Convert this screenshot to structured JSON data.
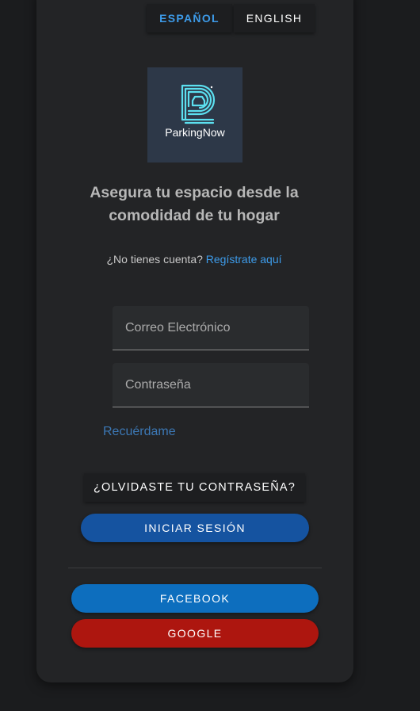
{
  "language": {
    "spanish": "ESPAÑOL",
    "english": "ENGLISH",
    "active": "ESPAÑOL",
    "active_color": "#3d9be9"
  },
  "logo": {
    "text": "ParkingNow",
    "icon": "parking-p-car-icon",
    "accent": "#5ce0f0",
    "bg": "#2d3848"
  },
  "tagline": "Asegura tu espacio desde la comodidad de tu hogar",
  "signup": {
    "prompt": "¿No tienes cuenta?",
    "link": "Regístrate aquí"
  },
  "form": {
    "email_placeholder": "Correo Electrónico",
    "email_value": "",
    "password_placeholder": "Contraseña",
    "password_value": "",
    "remember": "Recuérdame"
  },
  "buttons": {
    "forgot": "¿OLVIDASTE TU CONTRASEÑA?",
    "login": "INICIAR SESIÓN",
    "facebook": "FACEBOOK",
    "google": "GOOGLE"
  },
  "colors": {
    "login": "#1553a0",
    "facebook": "#0d6ebe",
    "google": "#ad160f",
    "link": "#3d9be9"
  }
}
